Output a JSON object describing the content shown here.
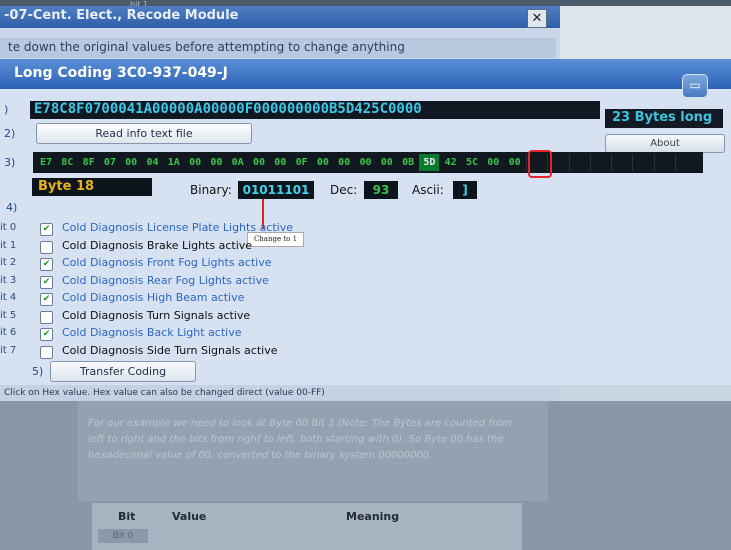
{
  "bg_window": {
    "title": "-07-Cent. Elect., Recode Module",
    "close_glyph": "✕",
    "subtitle": "te down the original values before attempting to change anything",
    "top_fragment": "bit 1"
  },
  "main_window": {
    "title": "Long Coding 3C0-937-049-J",
    "window_button_glyph": "▭"
  },
  "rows": {
    "r1": ")",
    "r2": "2)",
    "r3": "3)",
    "r4": "4)",
    "r5": "5)"
  },
  "coding_hex": "E78C8F0700041A00000A00000F000000000B5D425C0000",
  "bytes_long": "23 Bytes long",
  "read_info_button": "Read info text file",
  "about_button": "About",
  "bytes": [
    "E7",
    "8C",
    "8F",
    "07",
    "00",
    "04",
    "1A",
    "00",
    "00",
    "0A",
    "00",
    "00",
    "0F",
    "00",
    "00",
    "00",
    "00",
    "0B",
    "5D",
    "42",
    "5C",
    "00",
    "00"
  ],
  "selected_byte_index": 18,
  "byte_label": "Byte 18",
  "binary_label": "Binary:",
  "binary_value": "01011101",
  "dec_label": "Dec:",
  "dec_value": "93",
  "ascii_label": "Ascii:",
  "ascii_value": "]",
  "annotation_note": "Change to 1",
  "bits": [
    {
      "label": "it 0",
      "checked": true,
      "text": "Cold Diagnosis License Plate Lights active"
    },
    {
      "label": "it 1",
      "checked": false,
      "text": "Cold Diagnosis Brake Lights active"
    },
    {
      "label": "it 2",
      "checked": true,
      "text": "Cold Diagnosis Front Fog Lights active"
    },
    {
      "label": "it 3",
      "checked": true,
      "text": "Cold Diagnosis Rear Fog Lights active"
    },
    {
      "label": "it 4",
      "checked": true,
      "text": "Cold Diagnosis High Beam active"
    },
    {
      "label": "it 5",
      "checked": false,
      "text": "Cold Diagnosis Turn Signals active"
    },
    {
      "label": "it 6",
      "checked": true,
      "text": "Cold Diagnosis Back Light active"
    },
    {
      "label": "it 7",
      "checked": false,
      "text": "Cold Diagnosis Side Turn Signals active"
    }
  ],
  "transfer_button": "Transfer Coding",
  "status_text": "Click on Hex value. Hex value can also be changed direct (value 00-FF)",
  "doc_text": "For our example we need to look at Byte 00 Bit 3 (Note: The Bytes are counted from left to right and the bits from right to left, both starting with 0). So Byte 00 has the hexadecimal value of 00, converted to the binary system 00000000.",
  "table": {
    "headers": [
      "Bit",
      "Value",
      "Meaning"
    ],
    "first_cell": "Bit 0"
  },
  "colors": {
    "title_bar": "#2c63b4",
    "window_bg": "#d6e2f1",
    "hex_text": "#3fc8e6",
    "byte_text": "#39c44b",
    "highlight": "#e3262b",
    "checked_text": "#2d66c6"
  }
}
